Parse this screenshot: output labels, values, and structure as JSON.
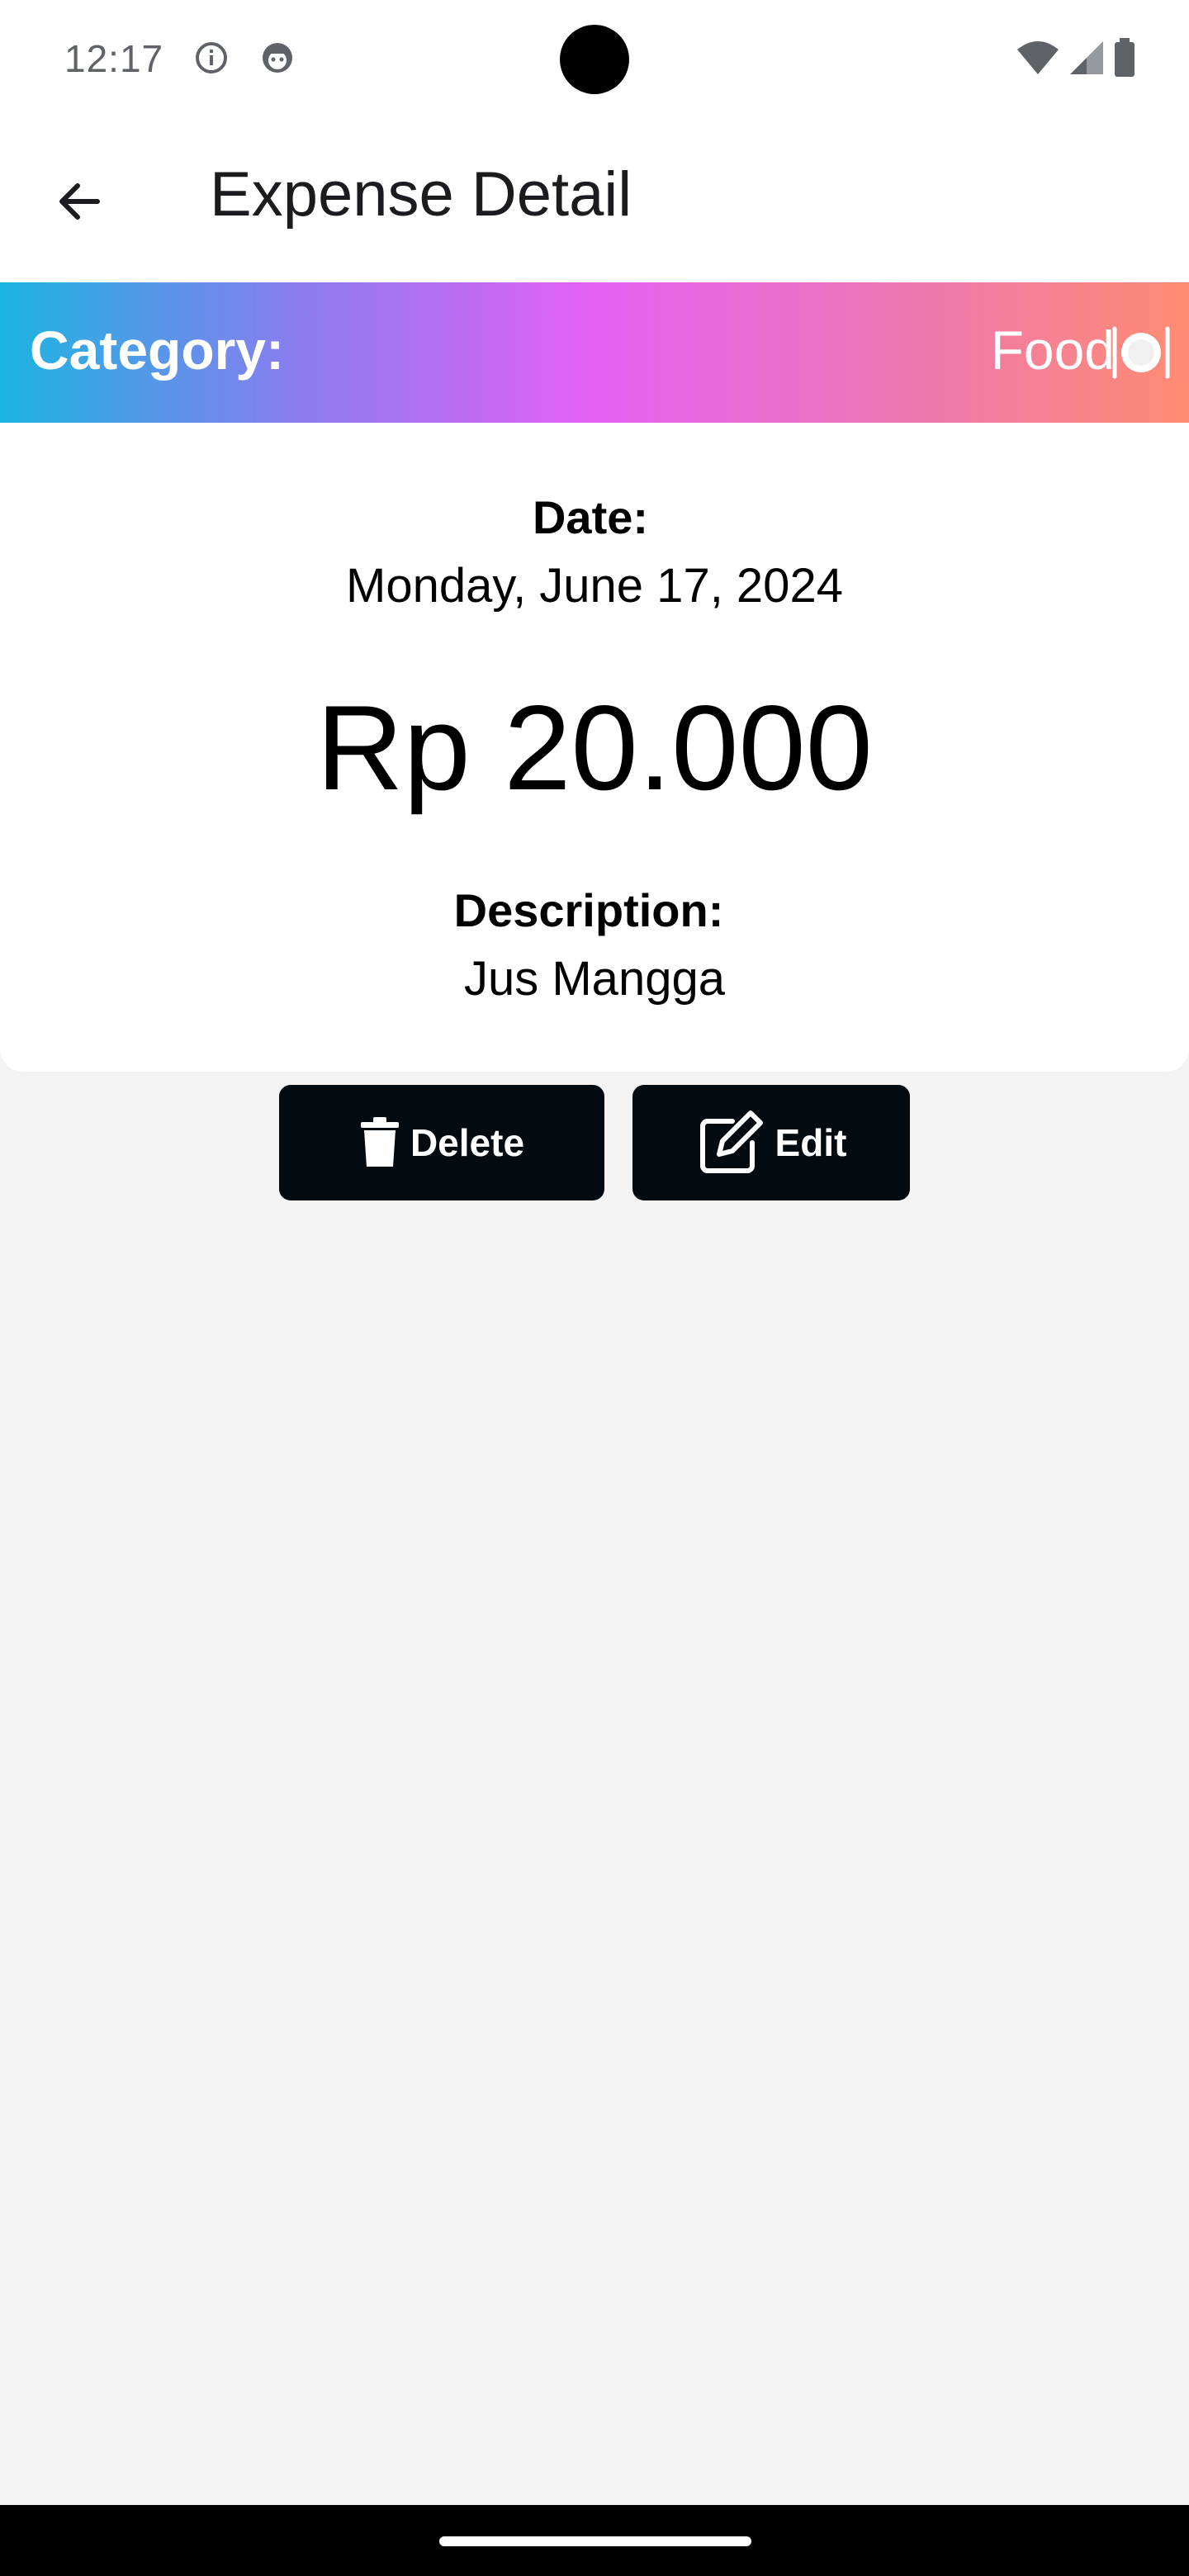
{
  "status_bar": {
    "time": "12:17",
    "icons": [
      "info-icon",
      "notification-face-icon",
      "wifi-icon",
      "signal-icon",
      "battery-icon"
    ]
  },
  "app_bar": {
    "title": "Expense Detail",
    "back_icon": "arrow-back-icon"
  },
  "category": {
    "label": "Category:",
    "value": "Food",
    "icon": "plate-cutlery-icon"
  },
  "detail": {
    "date_label": "Date:",
    "date_value": "Monday, June 17, 2024",
    "amount": "Rp 20.000",
    "description_label": "Description:",
    "description_value": "Jus Mangga"
  },
  "actions": {
    "delete_label": "Delete",
    "edit_label": "Edit"
  },
  "colors": {
    "gradient": [
      "#1cb5e0",
      "#e461f4",
      "#ff8c72"
    ],
    "button_bg": "#030b10",
    "page_bg": "#f3f3f3"
  }
}
